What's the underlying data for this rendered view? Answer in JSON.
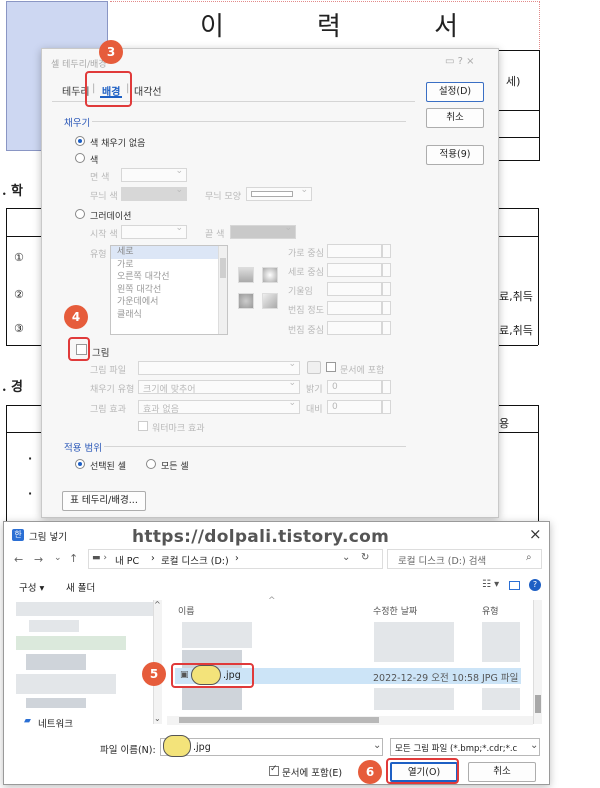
{
  "document": {
    "title_chars": [
      "이",
      "력",
      "서"
    ],
    "section1_prefix": ". 학",
    "section2_prefix": ". 경",
    "snip_age": "세)",
    "snip_role": "용",
    "circled": [
      "①",
      "②",
      "③"
    ],
    "row_suffix": "료,취득",
    "dot": "·"
  },
  "dialog1": {
    "title": "셀 테두리/배경",
    "title_controls": "▭ ? ×",
    "tabs": [
      "테두리",
      "배경",
      "대각선"
    ],
    "active_tab": "배경",
    "fill_group": "채우기",
    "no_fill_label": "색 채우기 없음",
    "color_label": "색",
    "face_color_label": "면 색",
    "pattern_color_label": "무늬 색",
    "pattern_shape_label": "무늬 모양",
    "gradient_label": "그러데이션",
    "start_color_label": "시작 색",
    "end_color_label": "끝 색",
    "type_label": "유형",
    "gradient_types": [
      "세로",
      "가로",
      "오른쪽 대각선",
      "왼쪽 대각선",
      "가운데에서",
      "클래식"
    ],
    "selected_type": "세로",
    "h_center_label": "가로 중심",
    "v_center_label": "세로 중심",
    "tilt_label": "기울임",
    "blur_label": "번짐 정도",
    "blur_center_label": "번짐 중심",
    "picture_label": "그림",
    "picture_file_label": "그림 파일",
    "include_in_doc_label": "문서에 포함",
    "fill_type_label": "채우기 유형",
    "fill_type_value": "크기에 맞추어",
    "brightness_label": "밝기",
    "brightness_value": "0",
    "picture_effect_label": "그림 효과",
    "picture_effect_value": "효과 없음",
    "contrast_label": "대비",
    "contrast_value": "0",
    "watermark_label": "워터마크 효과",
    "apply_range_group": "적용 범위",
    "selected_cells_label": "선택된 셀",
    "all_cells_label": "모든 셀",
    "border_bg_button": "표 테두리/배경...",
    "set_button": "설정(D)",
    "cancel_button": "취소",
    "apply_button": "적용(9)"
  },
  "dialog2": {
    "title": "그림 넣기",
    "close": "×",
    "breadcrumb": [
      "내 PC",
      "로컬 디스크 (D:)"
    ],
    "search_placeholder": "로컬 디스크 (D:) 검색",
    "organize_label": "구성 ▾",
    "new_folder_label": "새 폴더",
    "network_label": "네트워크",
    "col_name": "이름",
    "col_modified": "수정한 날짜",
    "col_type": "유형",
    "selected_file": {
      "name": ".jpg",
      "modified": "2022-12-29 오전 10:58",
      "type": "JPG 파일"
    },
    "filename_label": "파일 이름(N):",
    "filename_value": ".jpg",
    "filetype_filter": "모든 그림 파일 (*.bmp;*.cdr;*.c",
    "include_label": "문서에 포함(E)",
    "open_button": "열기(O)",
    "cancel_button": "취소"
  },
  "annotations": {
    "badges": [
      "3",
      "4",
      "5",
      "6"
    ],
    "badge_color": "#e65c3b",
    "highlight_color": "#e03a3a",
    "watermark_text": "https://dolpali.tistory.com"
  }
}
